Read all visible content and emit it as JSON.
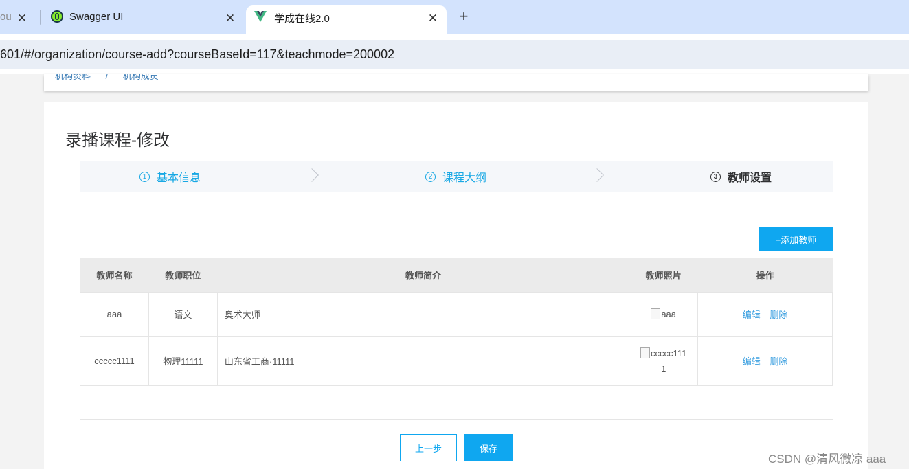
{
  "browser": {
    "tabs": [
      {
        "title": "ou",
        "active": false
      },
      {
        "title": "Swagger UI",
        "active": false
      },
      {
        "title": "学成在线2.0",
        "active": true
      }
    ],
    "new_tab": "+",
    "close_glyph": "✕",
    "url": "601/#/organization/course-add?courseBaseId=117&teachmode=200002"
  },
  "breadcrumb": {
    "items": [
      "机构资料",
      "/",
      "机构成员"
    ]
  },
  "page": {
    "title": "录播课程-修改",
    "steps": [
      {
        "num": "1",
        "label": "基本信息",
        "state": "done"
      },
      {
        "num": "2",
        "label": "课程大纲",
        "state": "done"
      },
      {
        "num": "3",
        "label": "教师设置",
        "state": "active"
      }
    ],
    "add_teacher_label": "+添加教师",
    "table": {
      "headers": [
        "教师名称",
        "教师职位",
        "教师简介",
        "教师照片",
        "操作"
      ],
      "rows": [
        {
          "name": "aaa",
          "position": "语文",
          "intro": "奥术大师",
          "photo_alt": "aaa",
          "photo_alt_2": "",
          "edit": "编辑",
          "delete": "删除"
        },
        {
          "name": "ccccc1111",
          "position": "物理11111",
          "intro": "山东省工商·11111",
          "photo_alt": "ccccc111",
          "photo_alt_2": "1",
          "edit": "编辑",
          "delete": "删除"
        }
      ]
    },
    "prev_label": "上一步",
    "save_label": "保存"
  },
  "watermark": "CSDN @清风微凉 aaa",
  "colors": {
    "primary": "#0fa7f0",
    "step_done": "#18a8e4",
    "tab_strip": "#d3e3fd",
    "omnibox": "#e9eef6"
  }
}
